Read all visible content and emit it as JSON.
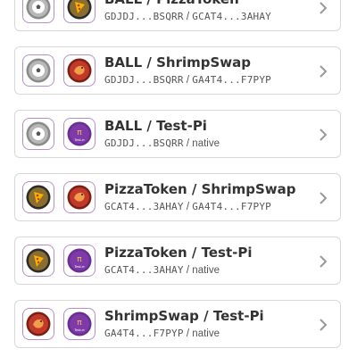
{
  "pairs": [
    {
      "title": "BALL / PizzaToken",
      "base_addr": "GDJDJ...BSQRR",
      "sep": " / ",
      "quote_addr": "GCAT4...3AHAY",
      "base_icon": "ball-coin-icon",
      "quote_icon": "pizza-coin-icon"
    },
    {
      "title": "BALL / ShrimpSwap",
      "base_addr": "GDJDJ...BSQRR",
      "sep": " / ",
      "quote_addr": "GA4T4...F7PYP",
      "base_icon": "ball-coin-icon",
      "quote_icon": "shrimp-coin-icon"
    },
    {
      "title": "BALL / Test-Pi",
      "base_addr": "GDJDJ...BSQRR",
      "sep": " / ",
      "quote_addr": "native",
      "base_icon": "ball-coin-icon",
      "quote_icon": "test-pi-coin-icon"
    },
    {
      "title": "PizzaToken / ShrimpSwap",
      "base_addr": "GCAT4...3AHAY",
      "sep": " / ",
      "quote_addr": "GA4T4...F7PYP",
      "base_icon": "pizza-coin-icon",
      "quote_icon": "shrimp-coin-icon"
    },
    {
      "title": "PizzaToken / Test-Pi",
      "base_addr": "GCAT4...3AHAY",
      "sep": " / ",
      "quote_addr": "native",
      "base_icon": "pizza-coin-icon",
      "quote_icon": "test-pi-coin-icon"
    },
    {
      "title": "ShrimpSwap / Test-Pi",
      "base_addr": "GA4T4...F7PYP",
      "sep": " / ",
      "quote_addr": "native",
      "base_icon": "shrimp-coin-icon",
      "quote_icon": "test-pi-coin-icon"
    }
  ],
  "icon_text": {
    "test_pi": "Test-π"
  },
  "colors": {
    "border": "#d8d8d8",
    "token_frame": "#b68fc9",
    "ball": "#8a8a8a",
    "pizza": "#2b2b2b",
    "shrimp": "#c0392b",
    "test_pi": "#6a2d91"
  }
}
